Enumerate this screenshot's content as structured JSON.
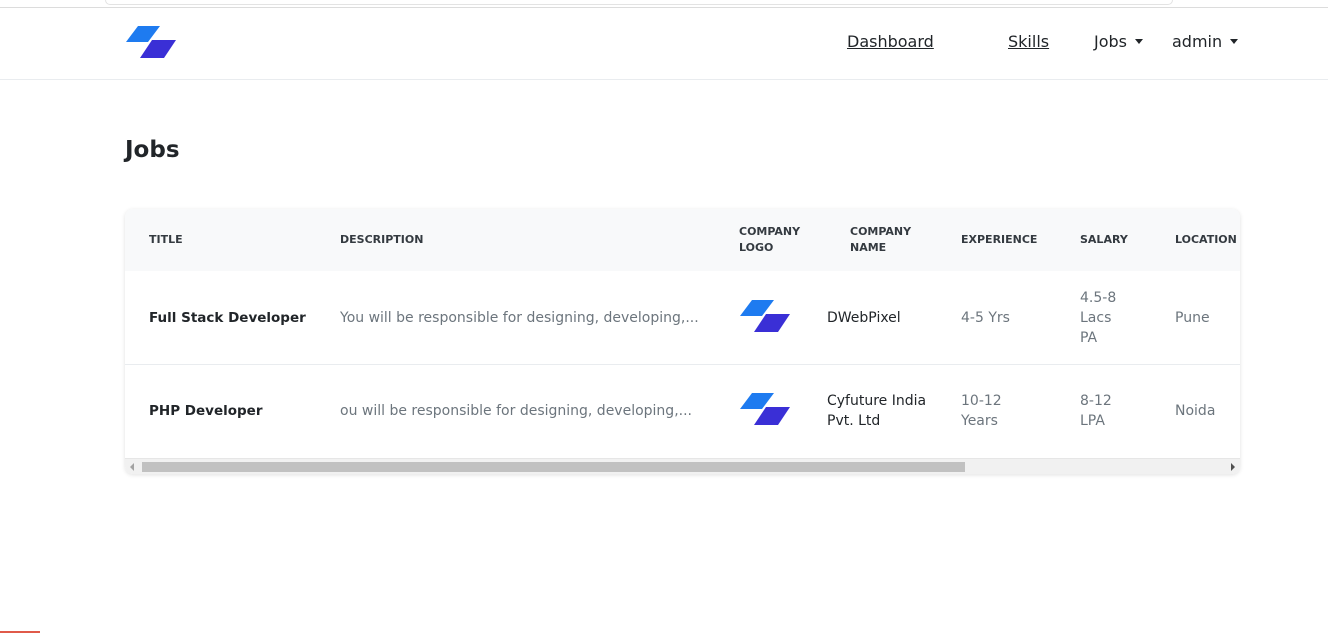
{
  "brand": {
    "icon": "brand-logo-icon",
    "colors": [
      "#1e7bf0",
      "#3a2fd6"
    ]
  },
  "nav": {
    "dashboard": "Dashboard",
    "skills": "Skills",
    "jobs": "Jobs",
    "user": "admin"
  },
  "page": {
    "title": "Jobs"
  },
  "table": {
    "headers": {
      "title": "TITLE",
      "description": "DESCRIPTION",
      "logo_line1": "COMPANY",
      "logo_line2": "LOGO",
      "name_line1": "COMPANY",
      "name_line2": "NAME",
      "experience": "EXPERIENCE",
      "salary": "SALARY",
      "location": "LOCATION"
    },
    "rows": [
      {
        "title": "Full Stack Developer",
        "description": "You will be responsible for designing, developing,...",
        "company_logo": "company-logo-icon",
        "company_name_line1": "DWebPixel",
        "company_name_line2": "",
        "experience_line1": "4-5 Yrs",
        "experience_line2": "",
        "salary_line1": "4.5-8",
        "salary_line2": "Lacs",
        "salary_line3": "PA",
        "location": "Pune"
      },
      {
        "title": "PHP Developer",
        "description": "ou will be responsible for designing, developing,...",
        "company_logo": "company-logo-icon",
        "company_name_line1": "Cyfuture India",
        "company_name_line2": "Pvt. Ltd",
        "experience_line1": "10-12",
        "experience_line2": "Years",
        "salary_line1": "8-12",
        "salary_line2": "LPA",
        "salary_line3": "",
        "location": "Noida"
      }
    ]
  },
  "colors": {
    "muted_text": "#6c757d",
    "header_bg": "#f8f9fa",
    "text": "#212529"
  }
}
